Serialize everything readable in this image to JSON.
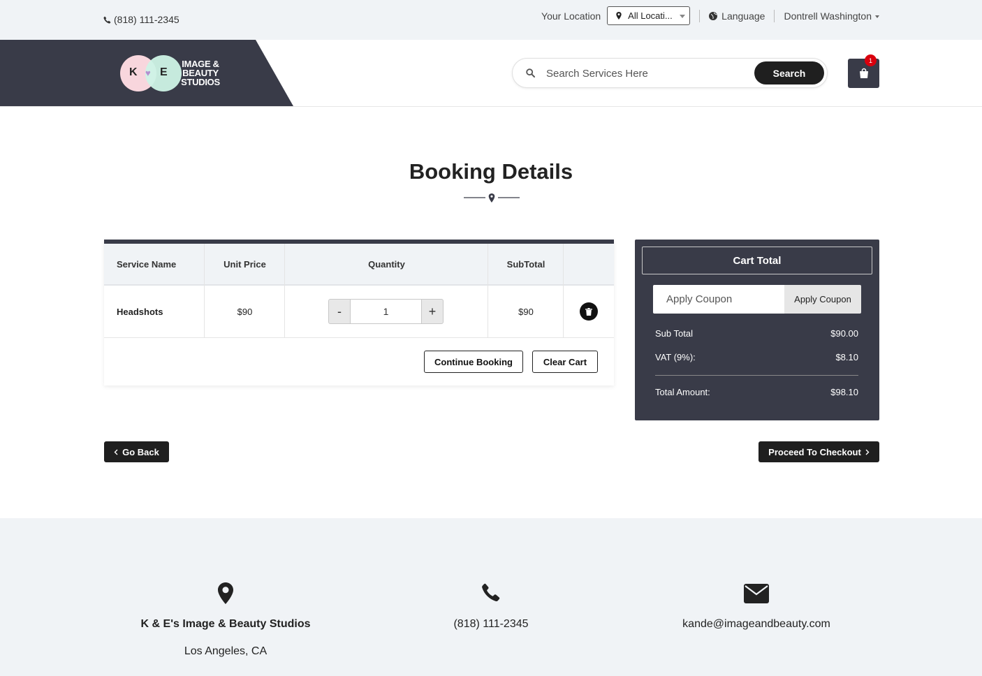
{
  "topbar": {
    "phone": "(818) 111-2345",
    "location_label": "Your Location",
    "location_value": "All Locati...",
    "language": "Language",
    "user": "Dontrell Washington"
  },
  "header": {
    "logo_text_line1": "IMAGE &",
    "logo_text_line2": "BEAUTY",
    "logo_text_line3": "STUDIOS",
    "logo_k": "K",
    "logo_e": "E",
    "search_placeholder": "Search Services Here",
    "search_button": "Search",
    "cart_count": "1"
  },
  "page": {
    "title": "Booking Details"
  },
  "cart_table": {
    "columns": [
      "Service Name",
      "Unit Price",
      "Quantity",
      "SubTotal"
    ],
    "rows": [
      {
        "service": "Headshots",
        "unit_price": "$90",
        "quantity": "1",
        "subtotal": "$90"
      }
    ],
    "minus": "-",
    "plus": "+",
    "continue_booking": "Continue Booking",
    "clear_cart": "Clear Cart"
  },
  "cart_total": {
    "title": "Cart Total",
    "coupon_placeholder": "Apply Coupon",
    "coupon_button": "Apply Coupon",
    "sub_total_label": "Sub Total",
    "sub_total_value": "$90.00",
    "vat_label": "VAT (9%):",
    "vat_value": "$8.10",
    "total_label": "Total Amount:",
    "total_value": "$98.10"
  },
  "actions": {
    "go_back": "Go Back",
    "proceed": "Proceed To Checkout"
  },
  "footer": {
    "business_name": "K & E's Image & Beauty Studios",
    "city": "Los Angeles, CA",
    "phone": "(818) 111-2345",
    "email": "kande@imageandbeauty.com"
  },
  "colors": {
    "dark": "#393b48",
    "black": "#1f1f1f",
    "badge": "#d9000d",
    "light_bg": "#f0f3f6"
  }
}
